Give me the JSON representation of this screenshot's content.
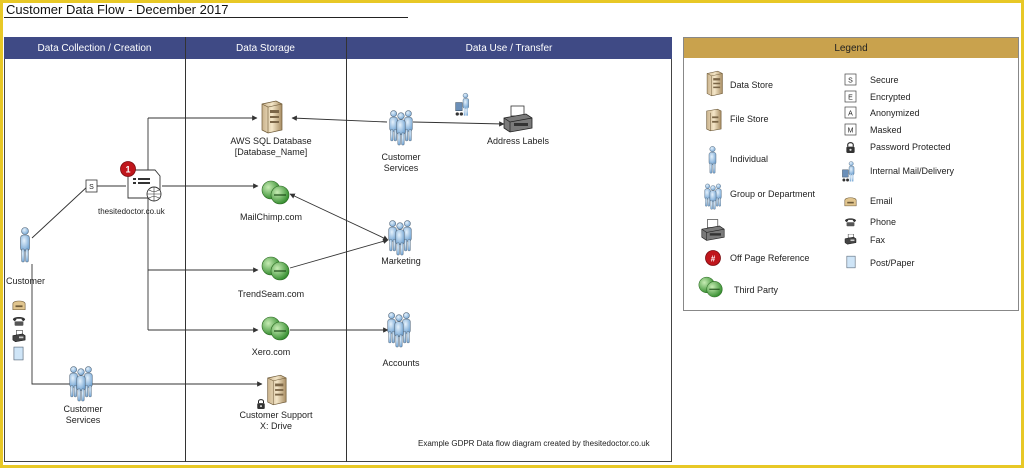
{
  "title": "Customer Data Flow - December 2017",
  "columns": [
    "Data Collection / Creation",
    "Data Storage",
    "Data Use / Transfer"
  ],
  "legend_title": "Legend",
  "nodes": {
    "customer": "Customer",
    "website": "thesitedoctor.co.uk",
    "website_badge": "1",
    "secure_tag": "S",
    "aws": [
      "AWS SQL Database",
      "[Database_Name]"
    ],
    "mailchimp": "MailChimp.com",
    "trendseam": "TrendSeam.com",
    "xero": "Xero.com",
    "customer_services_top": [
      "Customer",
      "Services"
    ],
    "address_labels": "Address Labels",
    "marketing": "Marketing",
    "accounts": "Accounts",
    "customer_services_bottom": [
      "Customer",
      "Services"
    ],
    "customer_support": [
      "Customer Support",
      "X: Drive"
    ]
  },
  "legend": {
    "left": [
      "Data Store",
      "File Store",
      "Individual",
      "Group or Department",
      "Off Page Reference",
      "Third Party"
    ],
    "offpage_symbol": "#",
    "right": [
      {
        "symbol": "S",
        "label": "Secure"
      },
      {
        "symbol": "E",
        "label": "Encrypted"
      },
      {
        "symbol": "A",
        "label": "Anonymized"
      },
      {
        "symbol": "M",
        "label": "Masked"
      }
    ],
    "right_icons": [
      "Password Protected",
      "Internal Mail/Delivery",
      "Email",
      "Phone",
      "Fax",
      "Post/Paper"
    ]
  },
  "caption": "Example GDPR Data flow diagram created by thesitedoctor.co.uk",
  "colors": {
    "header": "#3f4a85",
    "legend_header": "#c9a24d",
    "frame": "#e8c826",
    "person": "#9cc3e6",
    "third_party": "#5fb848",
    "badge": "#c0161c"
  }
}
